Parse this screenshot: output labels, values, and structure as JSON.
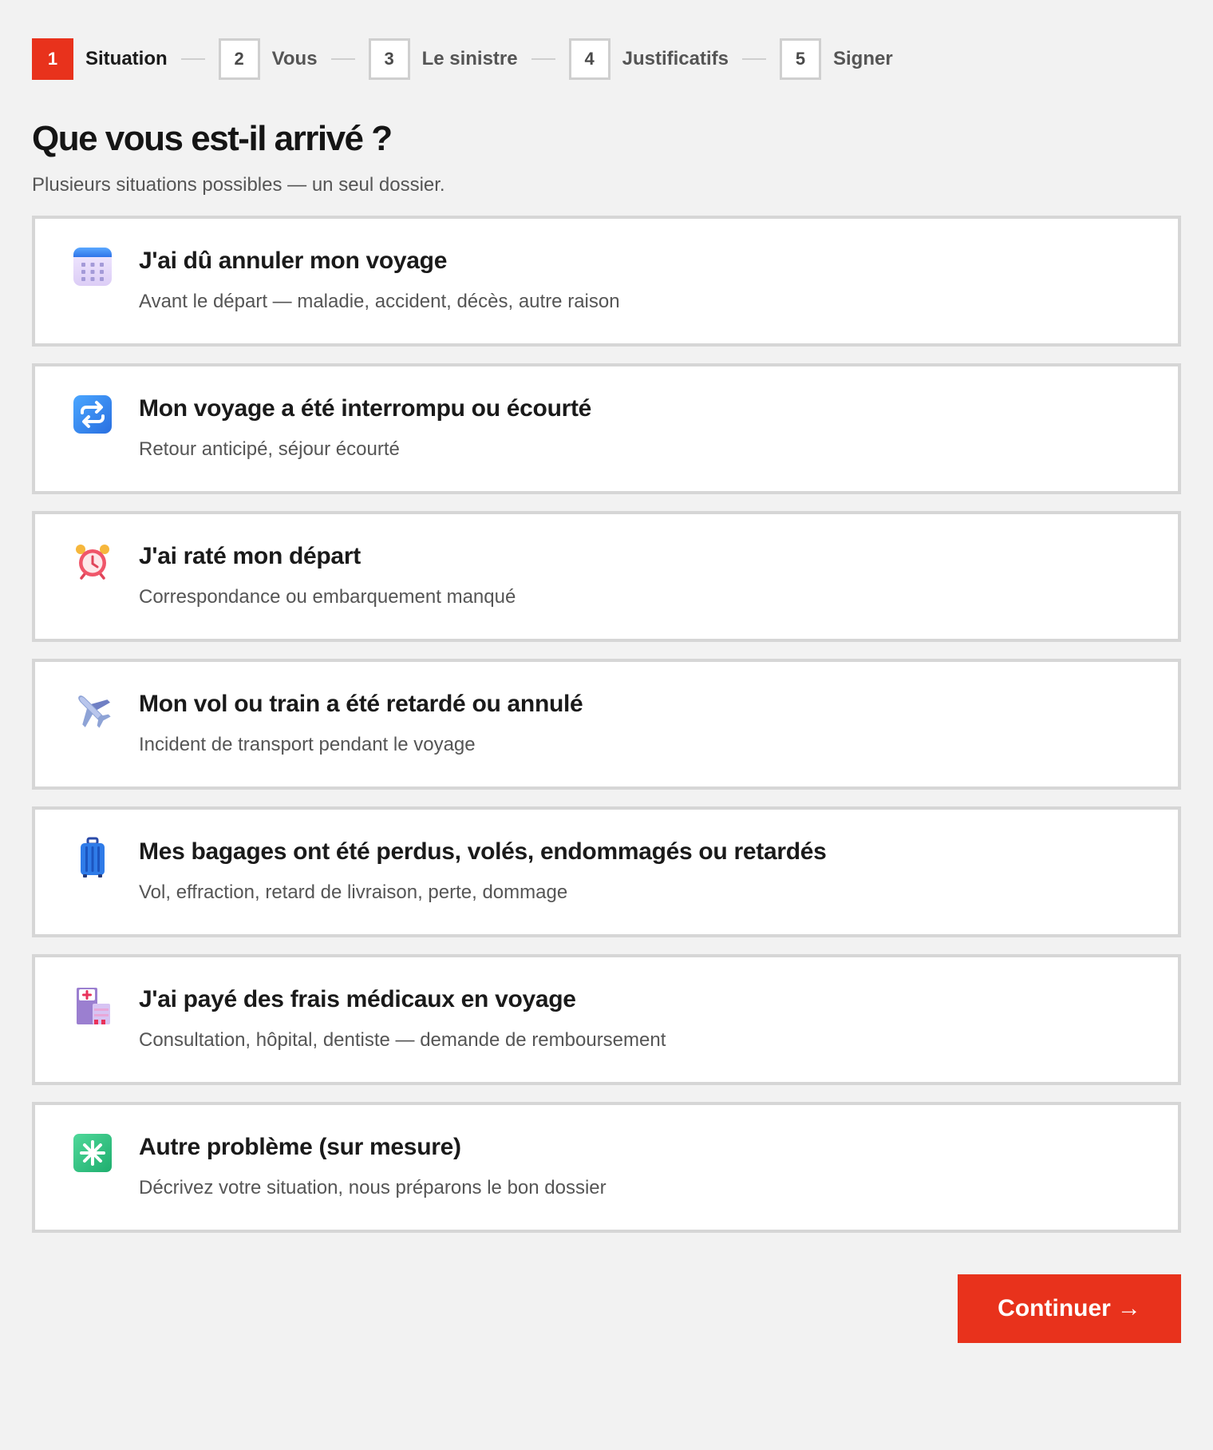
{
  "stepper": {
    "steps": [
      {
        "number": "1",
        "label": "Situation",
        "active": true
      },
      {
        "number": "2",
        "label": "Vous",
        "active": false
      },
      {
        "number": "3",
        "label": "Le sinistre",
        "active": false
      },
      {
        "number": "4",
        "label": "Justificatifs",
        "active": false
      },
      {
        "number": "5",
        "label": "Signer",
        "active": false
      }
    ]
  },
  "header": {
    "title": "Que vous est-il arrivé ?",
    "subtitle": "Plusieurs situations possibles — un seul dossier."
  },
  "options": [
    {
      "icon": "calendar-icon",
      "title": "J'ai dû annuler mon voyage",
      "description": "Avant le départ — maladie, accident, décès, autre raison"
    },
    {
      "icon": "repeat-arrows-icon",
      "title": "Mon voyage a été interrompu ou écourté",
      "description": "Retour anticipé, séjour écourté"
    },
    {
      "icon": "alarm-clock-icon",
      "title": "J'ai raté mon départ",
      "description": "Correspondance ou embarquement manqué"
    },
    {
      "icon": "airplane-icon",
      "title": "Mon vol ou train a été retardé ou annulé",
      "description": "Incident de transport pendant le voyage"
    },
    {
      "icon": "suitcase-icon",
      "title": "Mes bagages ont été perdus, volés, endommagés ou retardés",
      "description": "Vol, effraction, retard de livraison, perte, dommage"
    },
    {
      "icon": "hospital-icon",
      "title": "J'ai payé des frais médicaux en voyage",
      "description": "Consultation, hôpital, dentiste — demande de remboursement"
    },
    {
      "icon": "sparkle-icon",
      "title": "Autre problème (sur mesure)",
      "description": "Décrivez votre situation, nous préparons le bon dossier"
    }
  ],
  "footer": {
    "continue_label": "Continuer",
    "continue_arrow": "→"
  },
  "colors": {
    "accent": "#e8321c",
    "background": "#f2f2f2",
    "border": "#d6d6d6"
  }
}
